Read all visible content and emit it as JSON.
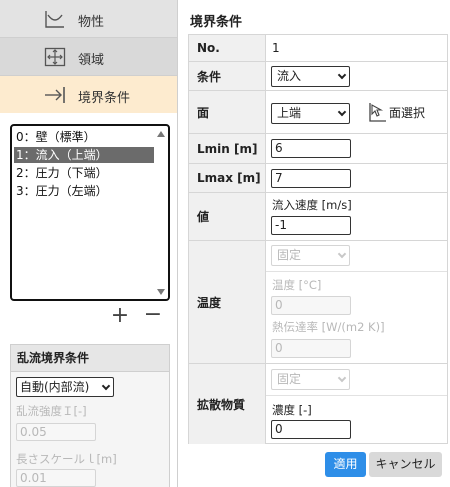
{
  "sidebar": {
    "tabs": [
      {
        "label": "物性",
        "icon": "graph-icon"
      },
      {
        "label": "領域",
        "icon": "move-arrows-icon"
      },
      {
        "label": "境界条件",
        "icon": "arrow-to-bar-icon"
      }
    ],
    "boundary_list": [
      "0：壁（標準）",
      "1：流入（上端）",
      "2：圧力（下端）",
      "3：圧力（左端）"
    ],
    "selected_index": 1,
    "add_label": "+",
    "remove_label": "−",
    "turbulence": {
      "title": "乱流境界条件",
      "mode": "自動(内部流)",
      "intensity_label": "乱流強度Ｉ[-]",
      "intensity_value": "0.05",
      "length_label": "長さスケールｌ[m]",
      "length_value": "0.01"
    }
  },
  "panel": {
    "title": "境界条件",
    "rows": {
      "no": {
        "label": "No.",
        "value": "1"
      },
      "condition": {
        "label": "条件",
        "value": "流入"
      },
      "face": {
        "label": "面",
        "value": "上端",
        "pick_label": "面選択"
      },
      "lmin": {
        "label": "Lmin [m]",
        "value": "6"
      },
      "lmax": {
        "label": "Lmax [m]",
        "value": "7"
      },
      "value": {
        "label": "値",
        "sublabel": "流入速度 [m/s]",
        "value": "-1"
      },
      "temperature": {
        "label": "温度",
        "mode": "固定",
        "temp_label": "温度 [°C]",
        "temp_value": "0",
        "htc_label": "熱伝達率 [W/(m2 K)]",
        "htc_value": "0"
      },
      "diffusion": {
        "label": "拡散物質",
        "mode": "固定",
        "conc_label": "濃度 [-]",
        "conc_value": "0"
      }
    },
    "apply_label": "適用",
    "cancel_label": "キャンセル"
  },
  "colors": {
    "accent": "#2e8ee8",
    "active_tab": "#fdebcf",
    "selected_row": "#6b6b6b"
  }
}
